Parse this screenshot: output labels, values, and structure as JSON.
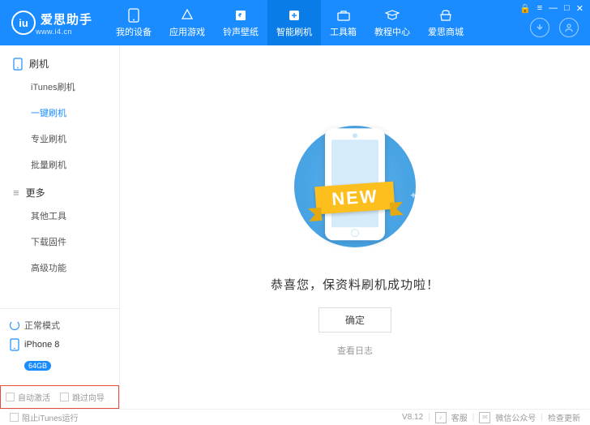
{
  "app": {
    "name": "爱思助手",
    "url": "www.i4.cn"
  },
  "nav": [
    {
      "label": "我的设备"
    },
    {
      "label": "应用游戏"
    },
    {
      "label": "铃声壁纸"
    },
    {
      "label": "智能刷机"
    },
    {
      "label": "工具箱"
    },
    {
      "label": "教程中心"
    },
    {
      "label": "爱思商城"
    }
  ],
  "sidebar": {
    "section1": "刷机",
    "items1": [
      "iTunes刷机",
      "一键刷机",
      "专业刷机",
      "批量刷机"
    ],
    "section2": "更多",
    "items2": [
      "其他工具",
      "下载固件",
      "高级功能"
    ],
    "status": "正常模式",
    "device": "iPhone 8",
    "storage": "64GB",
    "chk1": "自动激活",
    "chk2": "跳过向导"
  },
  "main": {
    "ribbon": "NEW",
    "success": "恭喜您，保资料刷机成功啦！",
    "confirm": "确定",
    "viewLog": "查看日志"
  },
  "footer": {
    "stopItunes": "阻止iTunes运行",
    "version": "V8.12",
    "support": "客服",
    "wechat": "微信公众号",
    "update": "检查更新"
  }
}
